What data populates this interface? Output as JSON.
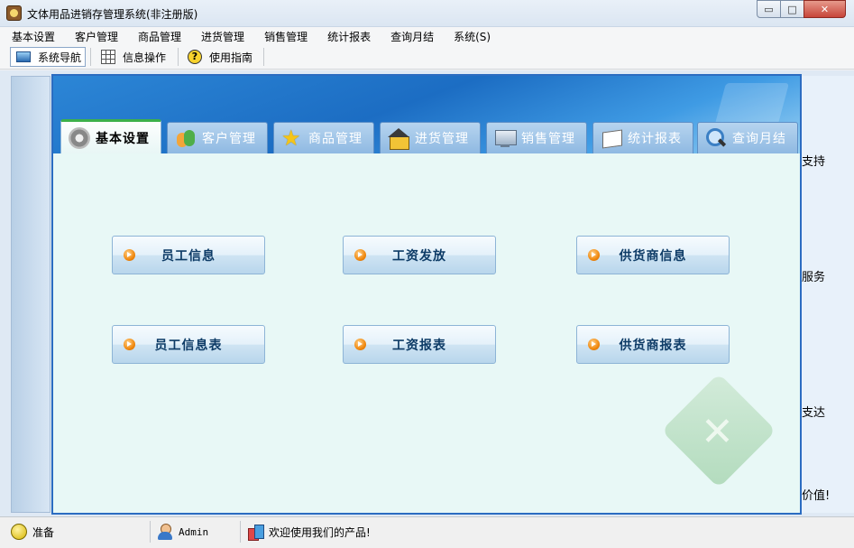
{
  "window": {
    "title": "文体用品进销存管理系统(非注册版)",
    "controls": {
      "minimize": "▭",
      "maximize": "□",
      "close": "✕"
    }
  },
  "menubar": {
    "items": [
      "基本设置",
      "客户管理",
      "商品管理",
      "进货管理",
      "销售管理",
      "统计报表",
      "查询月结",
      "系统(S)"
    ]
  },
  "toolbar": {
    "items": [
      {
        "label": "系统导航",
        "icon": "monitor-icon",
        "active": true
      },
      {
        "label": "信息操作",
        "icon": "grid-icon",
        "active": false
      },
      {
        "label": "使用指南",
        "icon": "help-icon",
        "active": false
      }
    ]
  },
  "navigation": {
    "tabs": [
      {
        "label": "基本设置",
        "icon": "gear-icon",
        "active": true
      },
      {
        "label": "客户管理",
        "icon": "people-icon",
        "active": false
      },
      {
        "label": "商品管理",
        "icon": "star-icon",
        "active": false
      },
      {
        "label": "进货管理",
        "icon": "house-icon",
        "active": false
      },
      {
        "label": "销售管理",
        "icon": "monitor-icon",
        "active": false
      },
      {
        "label": "统计报表",
        "icon": "book-icon",
        "active": false
      },
      {
        "label": "查询月结",
        "icon": "search-icon",
        "active": false
      }
    ],
    "buttons": [
      {
        "label": "员工信息"
      },
      {
        "label": "工资发放"
      },
      {
        "label": "供货商信息"
      },
      {
        "label": "员工信息表"
      },
      {
        "label": "工资报表"
      },
      {
        "label": "供货商报表"
      }
    ]
  },
  "right_panel": {
    "texts": [
      "支持",
      "服务",
      "支达",
      "价值!"
    ]
  },
  "statusbar": {
    "status": "准备",
    "user": "Admin",
    "message": "欢迎使用我们的产品!"
  },
  "colors": {
    "accent": "#2b6cc1",
    "content_bg": "#e8f8f6",
    "button_text": "#0d3b66",
    "tab_active_bar": "#3cb04a"
  }
}
